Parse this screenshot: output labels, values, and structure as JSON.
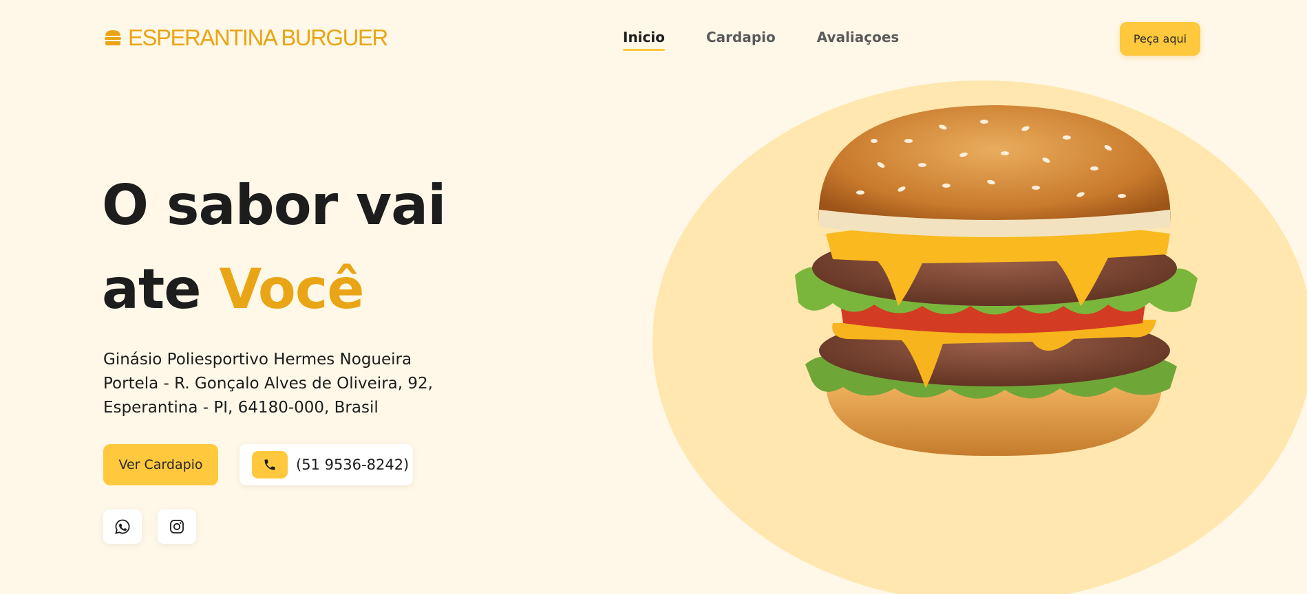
{
  "header": {
    "brand": "ESPERANTINA BURGUER",
    "brand_icon": "burger-icon",
    "nav": [
      {
        "label": "Inicio",
        "active": true
      },
      {
        "label": "Cardapio",
        "active": false
      },
      {
        "label": "Avaliaçoes",
        "active": false
      }
    ],
    "cta_label": "Peça aqui"
  },
  "hero": {
    "title_line1": "O sabor vai",
    "title_line2_prefix": "ate",
    "title_line2_accent": "Você",
    "address": "Ginásio Poliesportivo Hermes Nogueira Portela - R. Gonçalo Alves de Oliveira, 92, Esperantina - PI, 64180-000, Brasil",
    "menu_button_label": "Ver Cardapio",
    "phone": "(51 9536-8242)",
    "phone_icon": "phone-icon",
    "social_icons": [
      "whatsapp-icon",
      "instagram-icon"
    ]
  },
  "colors": {
    "background": "#fff8e8",
    "accent": "#e9a515",
    "button": "#ffc83d",
    "blob": "#ffe7af",
    "text": "#1d1d1d"
  }
}
